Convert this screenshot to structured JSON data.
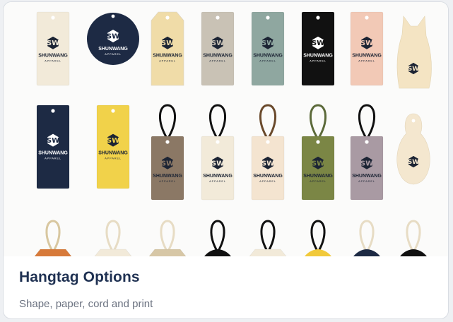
{
  "card": {
    "title": "Hangtag Options",
    "subtitle": "Shape, paper, cord and print"
  },
  "gallery": {
    "brand_name": "SHUNWANG",
    "brand_sub": "APPAREL",
    "logo_icon": "shunwang-monogram-icon",
    "rows": [
      {
        "tags": [
          {
            "shape": "rect",
            "paper": "#f2ead9",
            "ink": "#1c2434",
            "label": true
          },
          {
            "shape": "circle",
            "paper": "#1d2a44",
            "ink": "#ffffff",
            "label": true
          },
          {
            "shape": "notched",
            "paper": "#f0dca8",
            "ink": "#1c2434",
            "label": true
          },
          {
            "shape": "rect",
            "paper": "#c9c2b5",
            "ink": "#1c2434",
            "label": true
          },
          {
            "shape": "rect",
            "paper": "#8fa7a0",
            "ink": "#1c2434",
            "label": true
          },
          {
            "shape": "rect",
            "paper": "#111111",
            "ink": "#ffffff",
            "label": true
          },
          {
            "shape": "rect",
            "paper": "#f2c9b6",
            "ink": "#1c2434",
            "label": true
          },
          {
            "shape": "cat",
            "paper": "#f4e4c3",
            "ink": "#1c2434",
            "label": false
          }
        ]
      },
      {
        "tags": [
          {
            "shape": "rect",
            "paper": "#1d2a44",
            "ink": "#ffffff",
            "label": true
          },
          {
            "shape": "rect",
            "paper": "#f1d24a",
            "ink": "#1c2434",
            "label": true
          },
          {
            "shape": "rect",
            "paper": "#8b7865",
            "ink": "#1c2434",
            "label": true,
            "cord": "#111111"
          },
          {
            "shape": "rect",
            "paper": "#f2ead9",
            "ink": "#1c2434",
            "label": true,
            "cord": "#111111"
          },
          {
            "shape": "rect",
            "paper": "#f4e4d0",
            "ink": "#1c2434",
            "label": true,
            "cord": "#6a4a2c"
          },
          {
            "shape": "rect",
            "paper": "#7b8645",
            "ink": "#1c2434",
            "label": true,
            "cord": "#5c6a3a"
          },
          {
            "shape": "rect",
            "paper": "#a99aa3",
            "ink": "#1c2434",
            "label": true,
            "cord": "#111111"
          },
          {
            "shape": "penguin",
            "paper": "#f4e7cf",
            "ink": "#1c2434",
            "label": false
          }
        ]
      },
      {
        "tags": [
          {
            "shape": "partial",
            "paper": "#d77a3a",
            "cord": "#d8c7a0"
          },
          {
            "shape": "partial",
            "paper": "#f2ead9",
            "cord": "#e7dcc4"
          },
          {
            "shape": "partial",
            "paper": "#d7c7a6",
            "cord": "#e7dcc4"
          },
          {
            "shape": "partial-round",
            "paper": "#111111",
            "cord": "#111111"
          },
          {
            "shape": "partial",
            "paper": "#f2ead9",
            "cord": "#111111"
          },
          {
            "shape": "partial-round",
            "paper": "#f1c93a",
            "cord": "#111111"
          },
          {
            "shape": "partial-round",
            "paper": "#1d2a44",
            "cord": "#e7dcc4"
          },
          {
            "shape": "partial-round",
            "paper": "#111111",
            "cord": "#e7dcc4"
          }
        ]
      }
    ]
  }
}
